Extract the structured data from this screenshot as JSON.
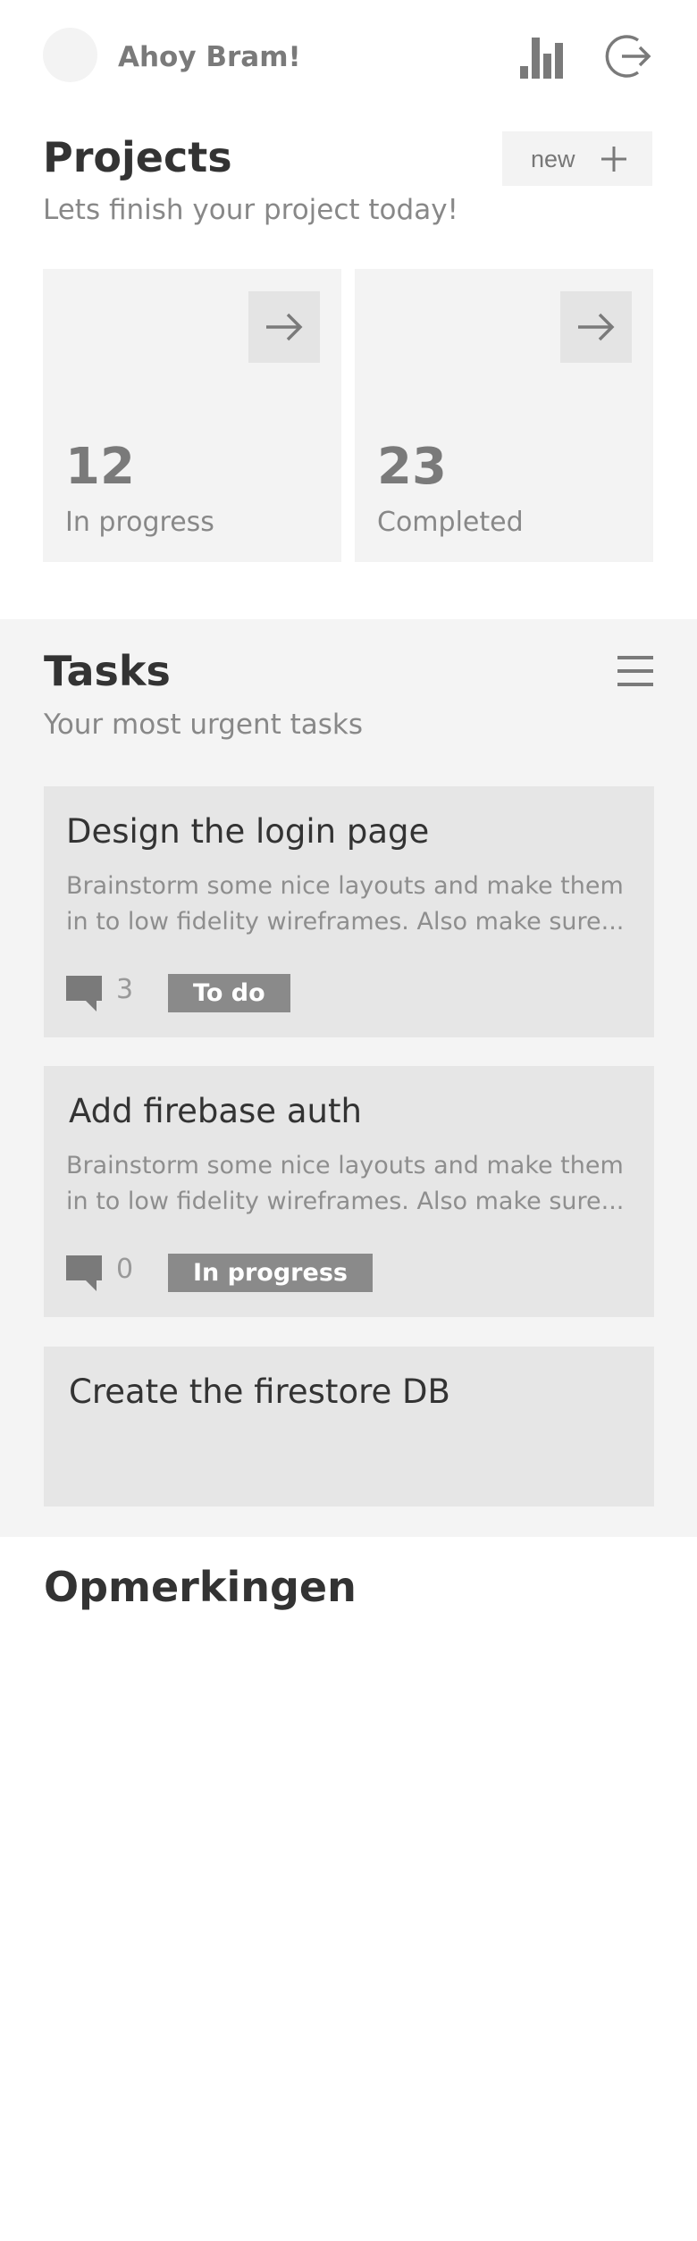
{
  "header": {
    "greeting": "Ahoy Bram!",
    "icons": [
      "avatar",
      "bar-chart-icon",
      "logout-icon"
    ]
  },
  "projects": {
    "title": "Projects",
    "new_label": "new",
    "subtitle": "Lets finish your project today!",
    "cards": [
      {
        "count": "12",
        "label": "In progress"
      },
      {
        "count": "23",
        "label": "Completed"
      }
    ]
  },
  "tasks": {
    "title": "Tasks",
    "subtitle": "Your most urgent tasks",
    "items": [
      {
        "title": "Design the login page",
        "description": "Brainstorm some nice layouts and make them in to low fidelity wireframes. Also make sure...",
        "comments": "3",
        "status": "To do"
      },
      {
        "title": "Add firebase auth",
        "description": "Brainstorm some nice layouts and make them in to low fidelity wireframes. Also make sure...",
        "comments": "0",
        "status": "In progress"
      },
      {
        "title": "Create the firestore DB"
      }
    ]
  },
  "notes": {
    "title": "Opmerkingen"
  },
  "colors": {
    "background": "#ffffff",
    "card": "#f3f3f3",
    "task_section": "#f4f4f4",
    "task_card": "#e6e6e6",
    "badge": "#8a8a8a",
    "icon": "#7a7a7a"
  }
}
